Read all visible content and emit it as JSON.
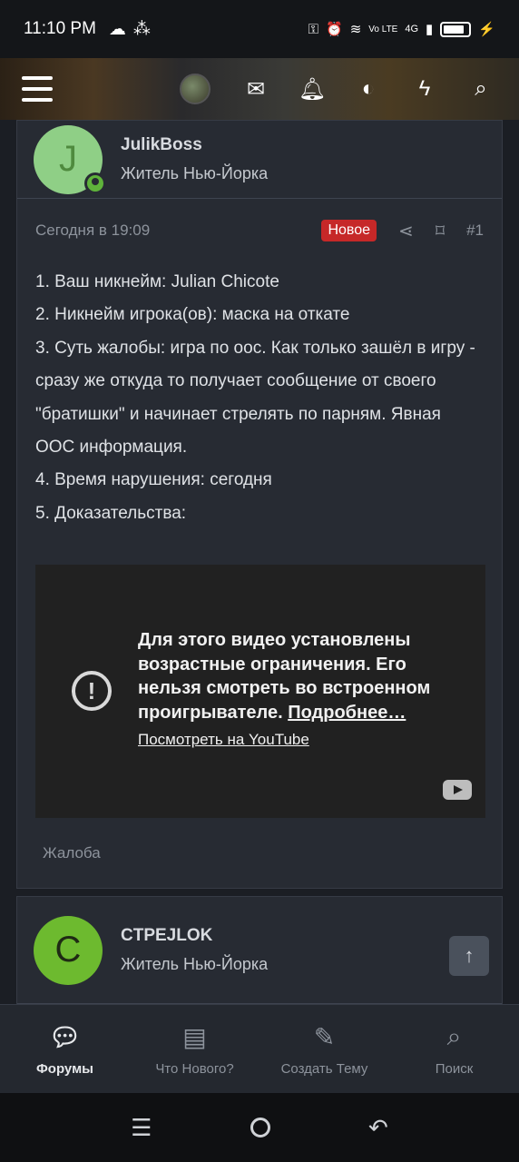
{
  "status_bar": {
    "time": "11:10 PM",
    "network": "4G",
    "volte": "Vo LTE"
  },
  "header": {
    "icons": [
      "menu-icon",
      "avatar",
      "mail-icon",
      "bell-icon",
      "contrast-icon",
      "bolt-icon",
      "search-icon"
    ]
  },
  "post1": {
    "author": {
      "initial": "J",
      "name": "JulikBoss",
      "title": "Житель Нью-Йорка",
      "avatar_bg": "#8fcf86",
      "avatar_fg": "#4f8a3e"
    },
    "date": "Сегодня в 19:09",
    "badge": "Новое",
    "number": "#1",
    "lines": [
      "1. Ваш никнейм: Julian Chicote",
      "2. Никнейм игрока(ов): маска на откате",
      "3. Суть жалобы: игра по оос. Как только зашёл в игру - сразу же откуда то получает сообщение от своего \"братишки\" и начинает стрелять по парням. Явная ООС информация.",
      "4. Время нарушения: сегодня",
      "5. Доказательства:"
    ],
    "video": {
      "message": "Для этого видео установлены возрастные ограничения. Его нельзя смотреть во встроенном проигрывателе.",
      "more_link": "Подробнее…",
      "youtube_link": "Посмотреть на YouTube"
    },
    "report": "Жалоба"
  },
  "post2": {
    "author": {
      "initial": "C",
      "name": "CTPEJLOK",
      "title": "Житель Нью-Йорка",
      "avatar_bg": "#6dba2f",
      "avatar_fg": "#1f2a14"
    }
  },
  "bottom_nav": [
    {
      "label": "Форумы",
      "icon": "forums-icon",
      "active": true
    },
    {
      "label": "Что Нового?",
      "icon": "document-icon",
      "active": false
    },
    {
      "label": "Создать Тему",
      "icon": "edit-icon",
      "active": false
    },
    {
      "label": "Поиск",
      "icon": "search-icon",
      "active": false
    }
  ],
  "colors": {
    "badge_new": "#c62828",
    "online": "#5fb33b",
    "background": "#1b1e24",
    "post_bg": "#272b33"
  }
}
